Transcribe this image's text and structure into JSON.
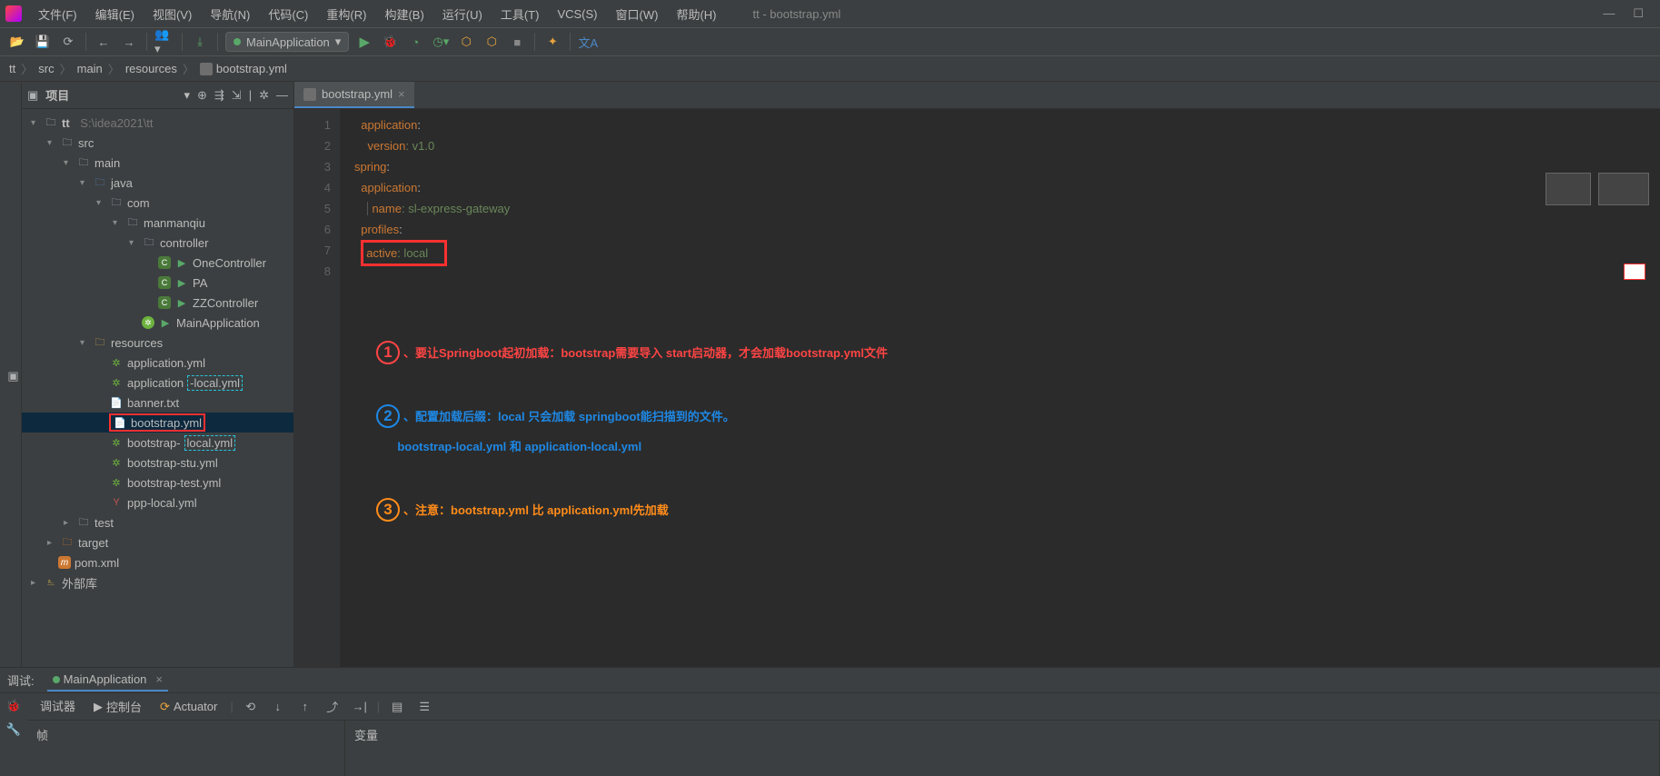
{
  "window": {
    "title": "tt - bootstrap.yml"
  },
  "menu": {
    "file": "文件(F)",
    "edit": "编辑(E)",
    "view": "视图(V)",
    "navigate": "导航(N)",
    "code": "代码(C)",
    "refactor": "重构(R)",
    "build": "构建(B)",
    "run": "运行(U)",
    "tools": "工具(T)",
    "vcs": "VCS(S)",
    "windowMenu": "窗口(W)",
    "help": "帮助(H)"
  },
  "runConfig": {
    "name": "MainApplication"
  },
  "breadcrumbs": {
    "items": [
      "tt",
      "src",
      "main",
      "resources",
      "bootstrap.yml"
    ]
  },
  "project": {
    "title": "项目",
    "root": {
      "label": "tt",
      "path": "S:\\idea2021\\tt"
    },
    "src": "src",
    "main": "main",
    "java": "java",
    "com": "com",
    "pkg": "manmanqiu",
    "controller": "controller",
    "classes": [
      "OneController",
      "PA",
      "ZZController"
    ],
    "mainApp": "MainApplication",
    "resources": "resources",
    "files": {
      "appYml": "application.yml",
      "appLocalPrefix": "application",
      "appLocalSuffix": "-local.yml",
      "banner": "banner.txt",
      "bootstrap": "bootstrap.yml",
      "bootstrapLocalPrefix": "bootstrap-",
      "bootstrapLocalSuffix": "local.yml",
      "bootstrapStu": "bootstrap-stu.yml",
      "bootstrapTest": "bootstrap-test.yml",
      "pppLocal": "ppp-local.yml"
    },
    "test": "test",
    "target": "target",
    "pom": "pom.xml",
    "extLib": "外部库"
  },
  "editor": {
    "tab": "bootstrap.yml",
    "lines": {
      "l1": {
        "k": "application",
        "v": ":"
      },
      "l2": {
        "k": "version",
        "v": ": v1.0"
      },
      "l3": {
        "k": "spring",
        "v": ":"
      },
      "l4": {
        "k": "application",
        "v": ":"
      },
      "l5": {
        "k": "name",
        "v": ": sl-express-gateway"
      },
      "l6": {
        "k": "profiles",
        "v": ":"
      },
      "l7": {
        "k": "active",
        "v": ": local"
      }
    }
  },
  "annotations": {
    "a1": "、要让Springboot起初加载：bootstrap需要导入 start启动器，才会加载bootstrap.yml文件",
    "a2a": "、配置加载后缀：local 只会加载 springboot能扫描到的文件。",
    "a2b": "bootstrap-local.yml 和 application-local.yml",
    "a3": "、注意：bootstrap.yml 比 application.yml先加载"
  },
  "debug": {
    "label": "调试:",
    "config": "MainApplication",
    "tabs": {
      "debugger": "调试器",
      "console": "控制台",
      "actuator": "Actuator"
    },
    "frames": "帧",
    "variables": "变量"
  }
}
